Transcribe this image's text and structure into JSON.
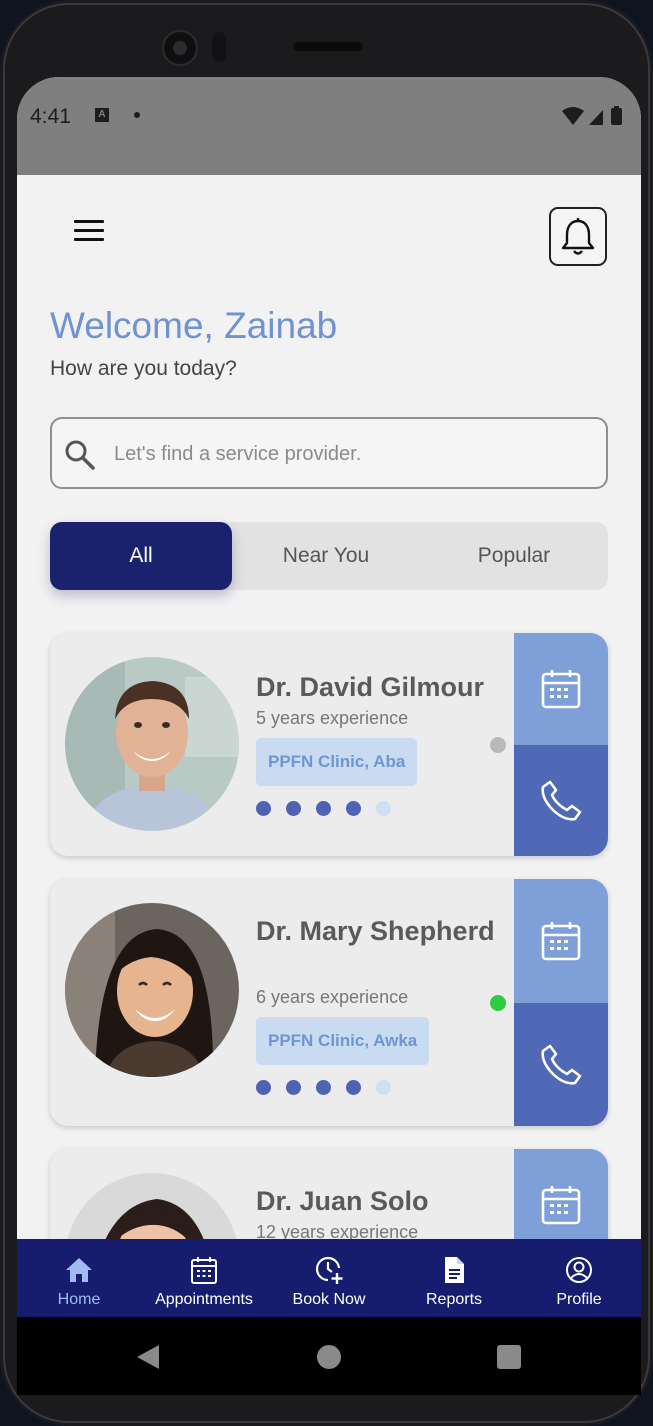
{
  "status_bar": {
    "time": "4:41",
    "notification_icon": "A"
  },
  "header": {
    "menu_icon": "hamburger-menu-icon",
    "bell_icon": "bell-icon"
  },
  "greeting": {
    "title": "Welcome, Zainab",
    "subtitle": "How are you today?"
  },
  "search": {
    "placeholder": "Let's find a service provider.",
    "value": ""
  },
  "tabs": [
    {
      "label": "All",
      "active": true
    },
    {
      "label": "Near You",
      "active": false
    },
    {
      "label": "Popular",
      "active": false
    }
  ],
  "doctors": [
    {
      "name": "Dr. David Gilmour",
      "experience": "5 years experience",
      "clinic": "PPFN Clinic, Aba",
      "rating": 4,
      "rating_max": 5,
      "online": false,
      "status_color": "#b9b9b9"
    },
    {
      "name": "Dr. Mary Shepherd",
      "experience": "6 years experience",
      "clinic": "PPFN Clinic, Awka",
      "rating": 4,
      "rating_max": 5,
      "online": true,
      "status_color": "#2ecc40"
    },
    {
      "name": "Dr. Juan Solo",
      "experience": "12 years experience"
    }
  ],
  "bottom_nav": [
    {
      "label": "Home",
      "icon": "home-icon",
      "active": true
    },
    {
      "label": "Appointments",
      "icon": "calendar-icon",
      "active": false
    },
    {
      "label": "Book Now",
      "icon": "clock-plus-icon",
      "active": false
    },
    {
      "label": "Reports",
      "icon": "document-icon",
      "active": false
    },
    {
      "label": "Profile",
      "icon": "user-circle-icon",
      "active": false
    }
  ],
  "colors": {
    "accent": "#6f92d3",
    "primary": "#1a226e",
    "nav_bg": "#161d6f",
    "calendar_btn": "#7f9fd8",
    "call_btn": "#5069b7",
    "clinic_bg": "#c9dbf1"
  }
}
